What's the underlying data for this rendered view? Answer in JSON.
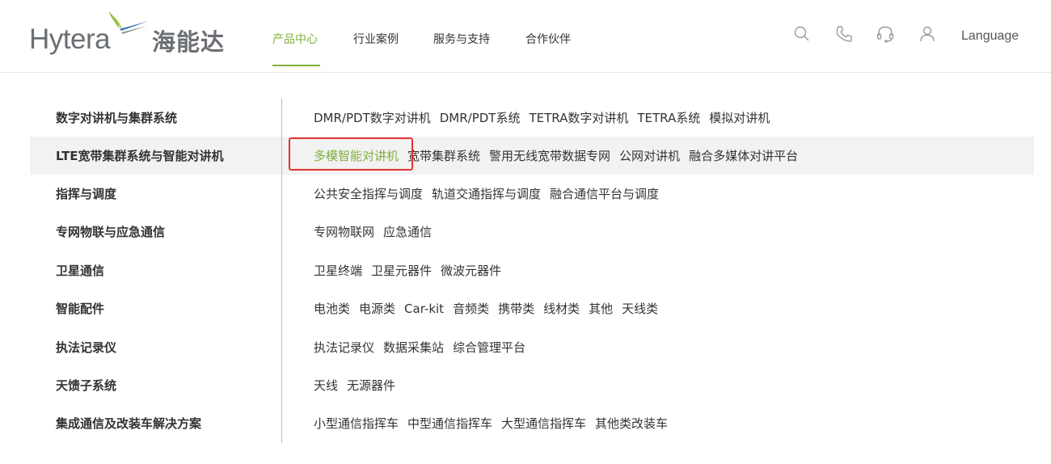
{
  "brand": {
    "name_en": "Hytera",
    "name_cn": "海能达",
    "green": "#80b03c",
    "gray": "#6b6f73"
  },
  "nav": [
    {
      "label": "产品中心",
      "active": true
    },
    {
      "label": "行业案例"
    },
    {
      "label": "服务与支持"
    },
    {
      "label": "合作伙伴"
    }
  ],
  "tools": {
    "icons": [
      "search-icon",
      "phone-icon",
      "headset-icon",
      "user-icon"
    ],
    "language": "Language"
  },
  "menu": [
    {
      "category": "数字对讲机与集群系统",
      "items": [
        "DMR/PDT数字对讲机",
        "DMR/PDT系统",
        "TETRA数字对讲机",
        "TETRA系统",
        "模拟对讲机"
      ]
    },
    {
      "category": "LTE宽带集群系统与智能对讲机",
      "items": [
        "多模智能对讲机",
        "宽带集群系统",
        "警用无线宽带数据专网",
        "公网对讲机",
        "融合多媒体对讲平台"
      ],
      "highlighted": true,
      "selected_item": 0,
      "annotation_color": "#e43232"
    },
    {
      "category": "指挥与调度",
      "items": [
        "公共安全指挥与调度",
        "轨道交通指挥与调度",
        "融合通信平台与调度"
      ]
    },
    {
      "category": "专网物联与应急通信",
      "items": [
        "专网物联网",
        "应急通信"
      ]
    },
    {
      "category": "卫星通信",
      "items": [
        "卫星终端",
        "卫星元器件",
        "微波元器件"
      ]
    },
    {
      "category": "智能配件",
      "items": [
        "电池类",
        "电源类",
        "Car-kit",
        "音频类",
        "携带类",
        "线材类",
        "其他",
        "天线类"
      ]
    },
    {
      "category": "执法记录仪",
      "items": [
        "执法记录仪",
        "数据采集站",
        "综合管理平台"
      ]
    },
    {
      "category": "天馈子系统",
      "items": [
        "天线",
        "无源器件"
      ]
    },
    {
      "category": "集成通信及改装车解决方案",
      "items": [
        "小型通信指挥车",
        "中型通信指挥车",
        "大型通信指挥车",
        "其他类改装车"
      ]
    }
  ]
}
